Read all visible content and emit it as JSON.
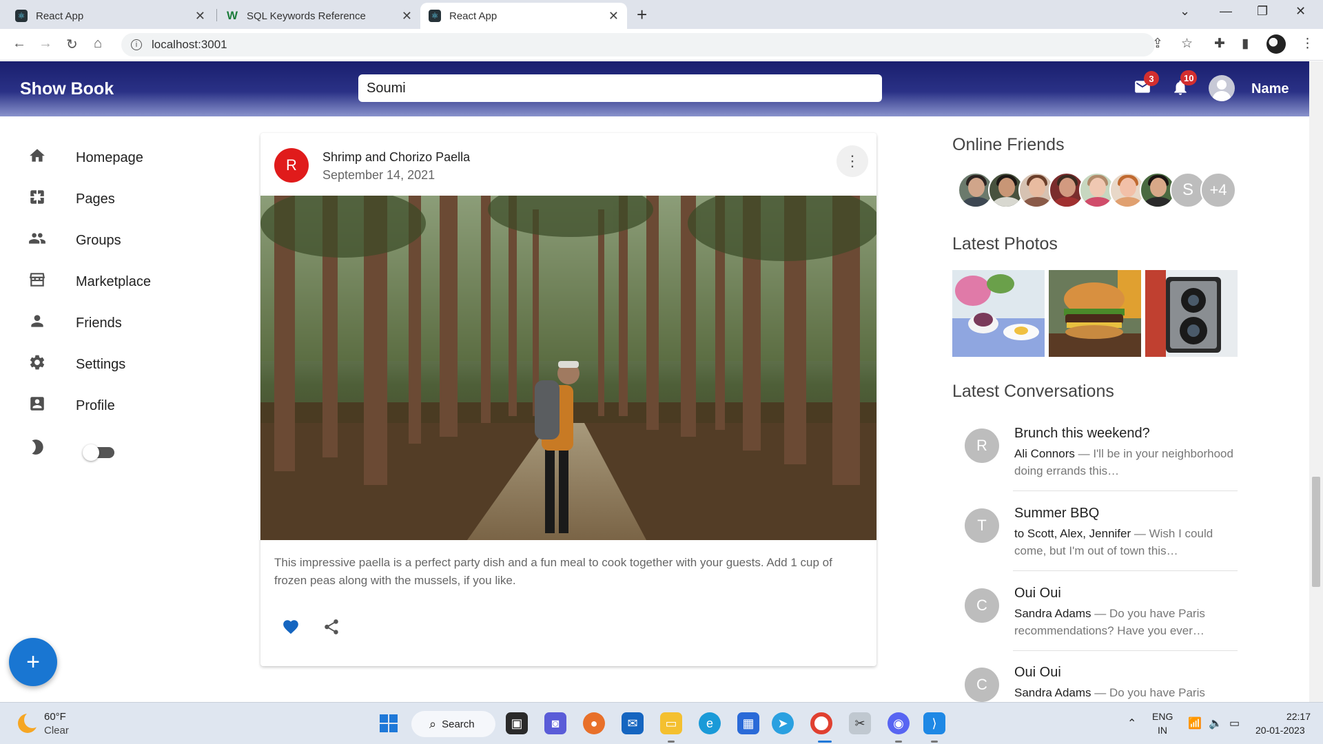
{
  "browser": {
    "tabs": [
      {
        "title": "React App",
        "icon": "react-icon"
      },
      {
        "title": "SQL Keywords Reference",
        "icon": "w3schools-icon"
      },
      {
        "title": "React App",
        "icon": "react-icon",
        "active": true
      }
    ],
    "url": "localhost:3001"
  },
  "appbar": {
    "brand": "Show Book",
    "search_value": "Soumi",
    "mail_badge": "3",
    "notification_badge": "10",
    "user_name": "Name",
    "gradient_top": "#1a1f6e"
  },
  "sidebar": {
    "items": [
      {
        "label": "Homepage",
        "icon": "home-icon"
      },
      {
        "label": "Pages",
        "icon": "pages-icon"
      },
      {
        "label": "Groups",
        "icon": "groups-icon"
      },
      {
        "label": "Marketplace",
        "icon": "storefront-icon"
      },
      {
        "label": "Friends",
        "icon": "person-icon"
      },
      {
        "label": "Settings",
        "icon": "gear-icon"
      },
      {
        "label": "Profile",
        "icon": "account-box-icon"
      }
    ],
    "fab_label": "+"
  },
  "post": {
    "avatar_letter": "R",
    "title": "Shrimp and Chorizo Paella",
    "date": "September 14, 2021",
    "text": "This impressive paella is a perfect party dish and a fun meal to cook together with your guests. Add 1 cup of frozen peas along with the mussels, if you like.",
    "avatar_color": "#e01b1b",
    "like_color": "#1565c0"
  },
  "right_panel": {
    "online_friends_heading": "Online Friends",
    "friend_letter": "S",
    "more_friends": "+4",
    "latest_photos_heading": "Latest Photos",
    "latest_conversations_heading": "Latest Conversations",
    "conversations": [
      {
        "avatar": "R",
        "title": "Brunch this weekend?",
        "sender": "Ali Connors",
        "preview": " — I'll be in your neighborhood doing errands this…"
      },
      {
        "avatar": "T",
        "title": "Summer BBQ",
        "sender": "to Scott, Alex, Jennifer",
        "preview": " — Wish I could come, but I'm out of town this…"
      },
      {
        "avatar": "C",
        "title": "Oui Oui",
        "sender": "Sandra Adams",
        "preview": " — Do you have Paris recommendations? Have you ever…"
      },
      {
        "avatar": "C",
        "title": "Oui Oui",
        "sender": "Sandra Adams",
        "preview": " — Do you have Paris"
      }
    ]
  },
  "taskbar": {
    "temperature": "60°F",
    "weather": "Clear",
    "search_label": "Search",
    "lang_top": "ENG",
    "lang_bottom": "IN",
    "time": "22:17",
    "date": "20-01-2023"
  }
}
